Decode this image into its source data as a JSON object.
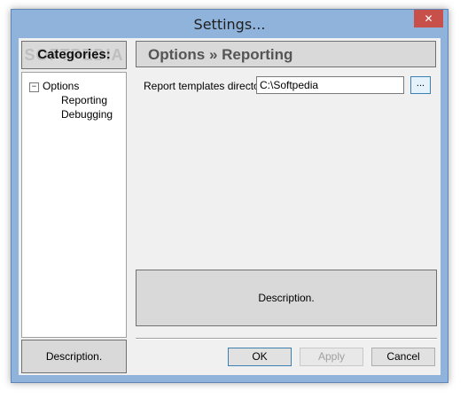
{
  "window": {
    "title": "Settings...",
    "close_glyph": "✕"
  },
  "categories": {
    "header": "Categories:",
    "watermark": "SOFTPEDIA",
    "tree": {
      "root": "Options",
      "root_expander": "−",
      "children": [
        "Reporting",
        "Debugging"
      ]
    },
    "description": "Description."
  },
  "section": {
    "header": "Options » Reporting",
    "field_label": "Report templates directory",
    "field_value": "C:\\Softpedia",
    "browse_label": "...",
    "description": "Description."
  },
  "buttons": {
    "ok": "OK",
    "apply": "Apply",
    "cancel": "Cancel"
  }
}
